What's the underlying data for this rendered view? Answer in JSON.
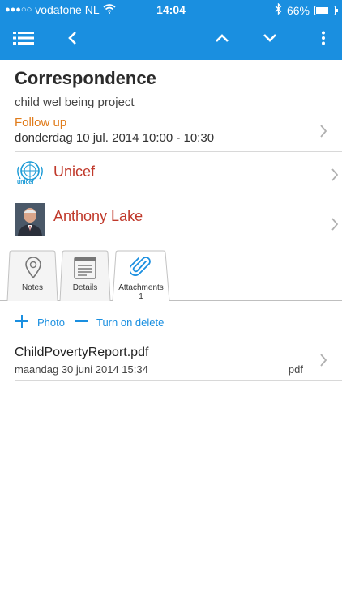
{
  "status_bar": {
    "carrier": "vodafone NL",
    "time": "14:04",
    "battery": "66%",
    "signal_dots": "●●●○○"
  },
  "nav": {
    "menu_icon": "list-menu-icon",
    "back_icon": "chevron-left-icon",
    "up_icon": "chevron-up-icon",
    "down_icon": "chevron-down-icon",
    "more_icon": "vertical-dots-icon"
  },
  "record": {
    "title": "Correspondence",
    "subtitle": "child wel being project",
    "follow_up_label": "Follow up",
    "follow_up_date": "donderdag 10 jul. 2014 10:00 - 10:30"
  },
  "contacts": [
    {
      "name": "Unicef",
      "logo_text": "unicef"
    },
    {
      "name": "Anthony Lake"
    }
  ],
  "tabs": [
    {
      "label": "Notes",
      "icon": "map-pin-icon"
    },
    {
      "label": "Details",
      "icon": "details-icon"
    },
    {
      "label": "Attachments",
      "count": "1",
      "icon": "paperclip-icon"
    }
  ],
  "actions": {
    "add_photo": "Photo",
    "turn_on_delete": "Turn on delete"
  },
  "attachments": [
    {
      "name": "ChildPovertyReport.pdf",
      "date": "maandag 30 juni 2014 15:34",
      "type": "pdf"
    }
  ],
  "colors": {
    "accent": "#1a8fe0",
    "follow_up": "#e07b1a",
    "contact_name": "#c0392b"
  }
}
